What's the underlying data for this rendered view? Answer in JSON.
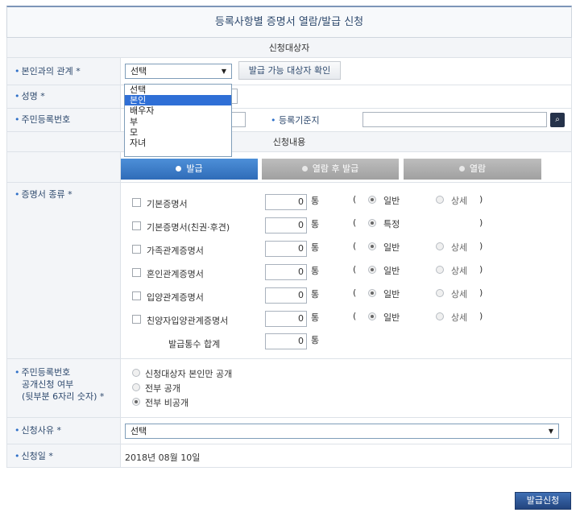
{
  "title": "등록사항별 증명서 열람/발급 신청",
  "sections": {
    "target": "신청대상자",
    "content": "신청내용"
  },
  "relation": {
    "label": "본인과의 관계 *",
    "selected": "선택",
    "confirm_button": "발급 가능 대상자 확인",
    "options": [
      "선택",
      "본인",
      "배우자",
      "부",
      "모",
      "자녀"
    ],
    "highlighted": "본인"
  },
  "name": {
    "label": "성명 *"
  },
  "resident": {
    "label": "주민등록번호",
    "base_label": "등록기준지"
  },
  "tabs": [
    {
      "label": "발급",
      "active": true
    },
    {
      "label": "열람 후 발급",
      "active": false
    },
    {
      "label": "열람",
      "active": false
    }
  ],
  "certificates": {
    "label": "증명서 종류 *",
    "unit": "통",
    "items": [
      {
        "name": "기본증명서",
        "count": "0",
        "opt1": "일반",
        "opt2": "상세"
      },
      {
        "name": "기본증명서(친권·후견)",
        "count": "0",
        "opt1": "특정",
        "opt2": ""
      },
      {
        "name": "가족관계증명서",
        "count": "0",
        "opt1": "일반",
        "opt2": "상세"
      },
      {
        "name": "혼인관계증명서",
        "count": "0",
        "opt1": "일반",
        "opt2": "상세"
      },
      {
        "name": "입양관계증명서",
        "count": "0",
        "opt1": "일반",
        "opt2": "상세"
      },
      {
        "name": "친양자입양관계증명서",
        "count": "0",
        "opt1": "일반",
        "opt2": "상세"
      }
    ],
    "total_label": "발급통수 합계",
    "total_count": "0"
  },
  "disclosure": {
    "label_line1": "주민등록번호",
    "label_line2": "공개신청 여부",
    "label_line3": "(뒷부분 6자리 숫자) *",
    "options": [
      "신청대상자 본인만 공개",
      "전부 공개",
      "전부 비공개"
    ],
    "selected_index": 2
  },
  "reason": {
    "label": "신청사유 *",
    "selected": "선택"
  },
  "date": {
    "label": "신청일 *",
    "value": "2018년 08월 10일"
  },
  "submit_label": "발급신청"
}
